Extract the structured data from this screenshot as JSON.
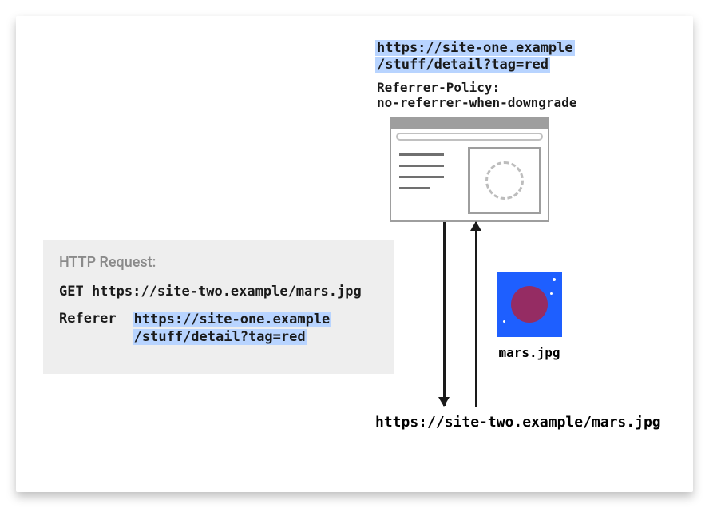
{
  "origin": {
    "url_line1": "https://site-one.example",
    "url_line2": "/stuff/detail?tag=red",
    "policy_line1": "Referrer-Policy:",
    "policy_line2": "no-referrer-when-downgrade"
  },
  "http": {
    "title": "HTTP Request:",
    "get_line": "GET https://site-two.example/mars.jpg",
    "referer_label": "Referer",
    "referer_line1": "https://site-one.example",
    "referer_line2": "/stuff/detail?tag=red"
  },
  "resource": {
    "filename": "mars.jpg",
    "url": "https://site-two.example/mars.jpg"
  }
}
